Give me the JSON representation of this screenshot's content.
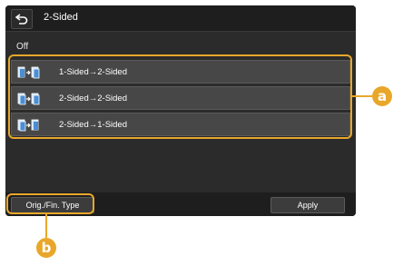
{
  "header": {
    "title": "2-Sided"
  },
  "current_setting": "Off",
  "options": [
    {
      "label": "1-Sided→2-Sided"
    },
    {
      "label": "2-Sided→2-Sided"
    },
    {
      "label": "2-Sided→1-Sided"
    }
  ],
  "footer": {
    "orig_fin_type_label": "Orig./Fin. Type",
    "apply_label": "Apply"
  },
  "callouts": {
    "a": "a",
    "b": "b"
  },
  "colors": {
    "accent": "#e8a72a",
    "screen_bg": "#2b2b2b",
    "option_bg": "#474747",
    "text": "#ffffff"
  }
}
